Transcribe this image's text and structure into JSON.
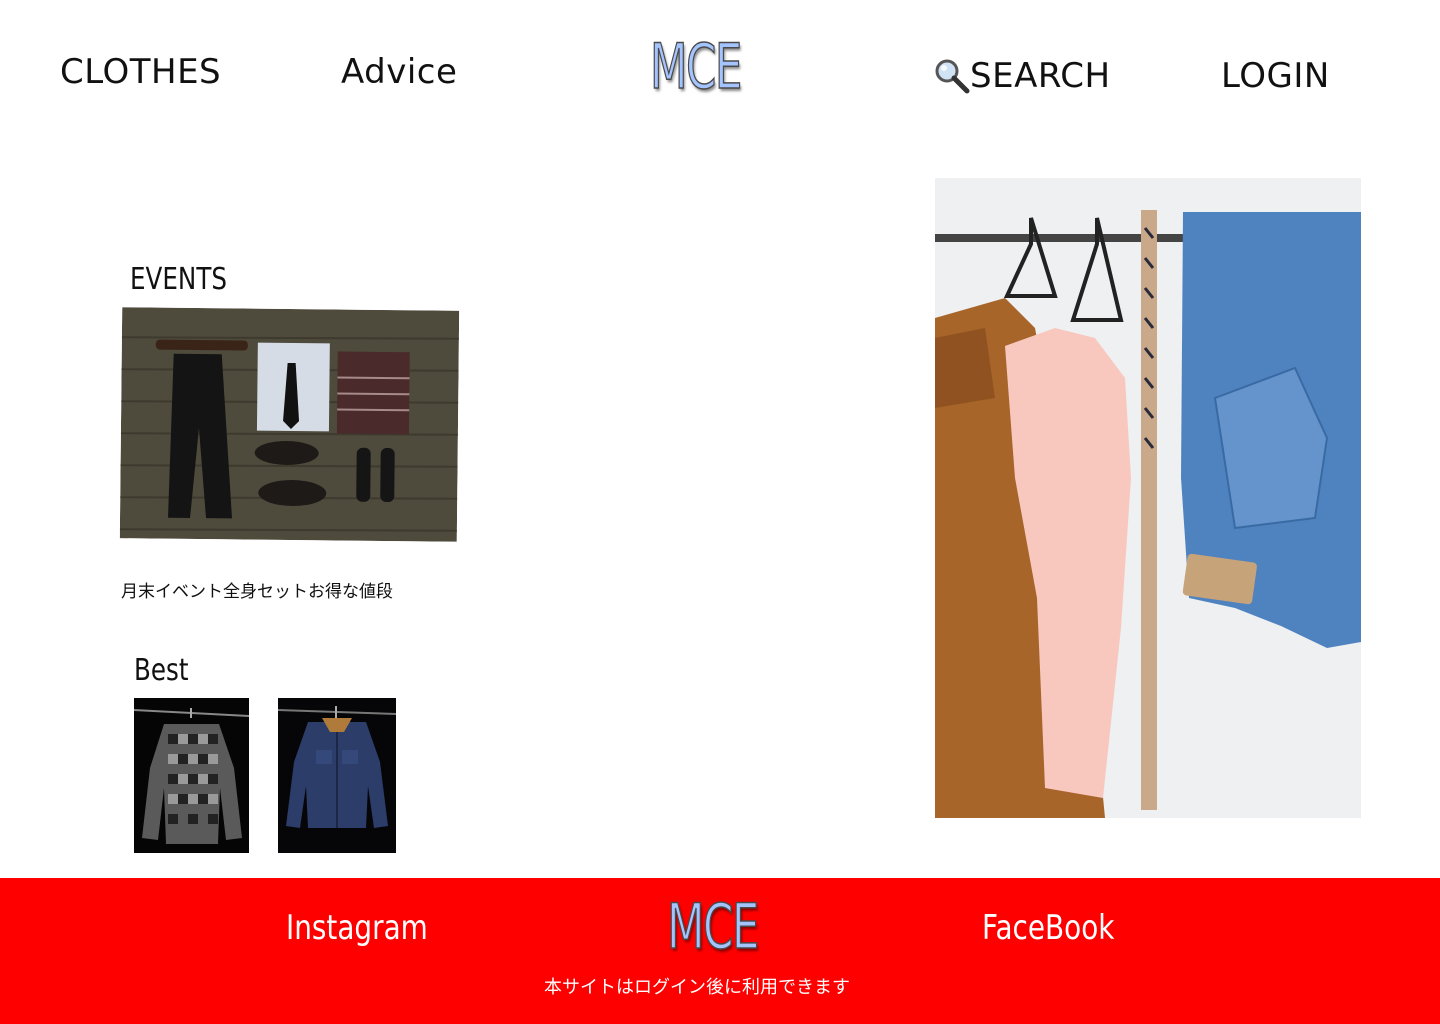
{
  "header": {
    "nav_left": [
      "CLOTHES",
      "Advice"
    ],
    "logo": "MCE",
    "search_icon": "magnifier-glyph",
    "search_label": "SEARCH",
    "login_label": "LOGIN"
  },
  "events": {
    "title": "EVENTS",
    "image": "flat-lay-outfit-photo",
    "caption": "月末イベント全身セットお得な値段"
  },
  "best": {
    "title": "Best",
    "items": [
      {
        "image": "plaid-shirt-photo"
      },
      {
        "image": "denim-jacket-photo"
      }
    ]
  },
  "hero": {
    "image": "clothes-rack-photo"
  },
  "footer": {
    "instagram": "Instagram",
    "logo": "MCE",
    "facebook": "FaceBook",
    "note": "本サイトはログイン後に利用できます",
    "background": "#ff0000"
  },
  "colors": {
    "logo_fill": "#a4c4ff",
    "footer_bg": "#ff0000"
  }
}
